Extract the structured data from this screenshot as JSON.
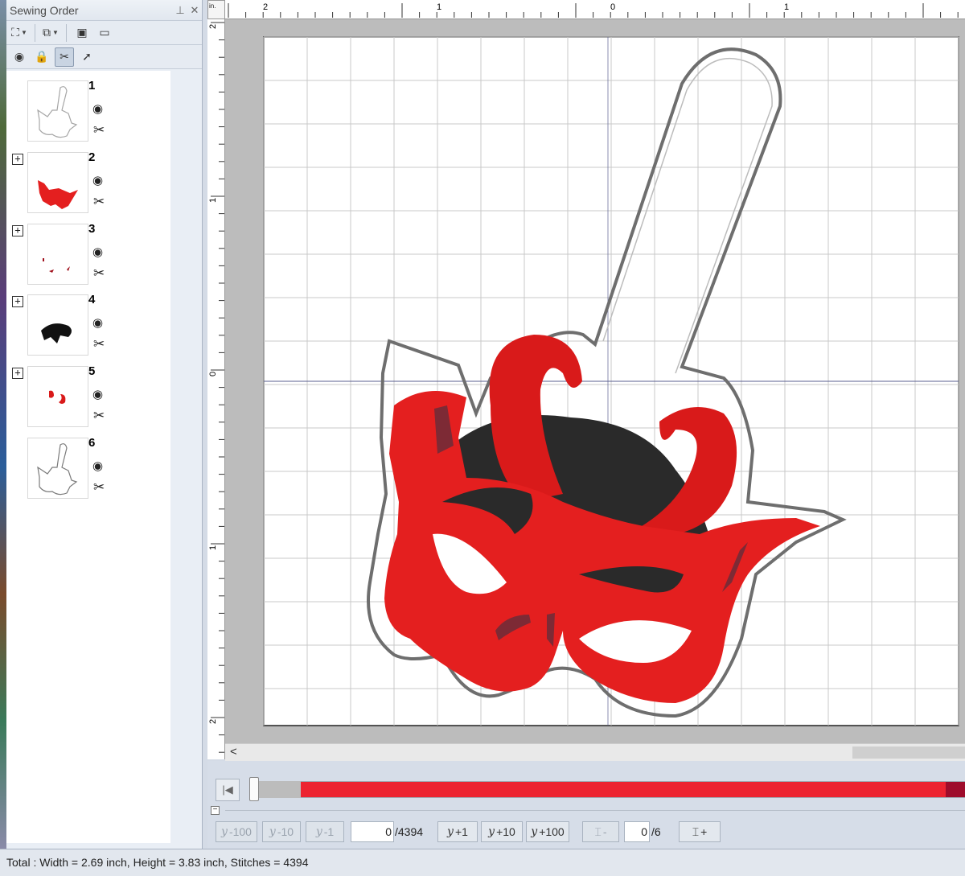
{
  "panel": {
    "title": "Sewing Order",
    "pin_glyph": "ᵃ",
    "close_glyph": "✕",
    "toolbar1": [
      {
        "name": "select-design-icon",
        "glyph": "⛶",
        "dropdown": true
      },
      {
        "name": "group-icon",
        "glyph": "⧉",
        "dropdown": true
      },
      {
        "name": "color-order-icon",
        "glyph": "▣",
        "dropdown": false
      },
      {
        "name": "frame-icon",
        "glyph": "▭",
        "dropdown": false
      }
    ],
    "toolbar2": [
      {
        "name": "visibility-icon",
        "glyph": "◉"
      },
      {
        "name": "lock-icon",
        "glyph": "🔒"
      },
      {
        "name": "cut-tool-icon",
        "glyph": "✂"
      },
      {
        "name": "pointer-icon",
        "glyph": "➚"
      }
    ],
    "items": [
      {
        "num": "1",
        "expandable": false,
        "color": "#a6a6a6",
        "kind": "outline"
      },
      {
        "num": "2",
        "expandable": true,
        "color": "#e41f1f",
        "kind": "mask"
      },
      {
        "num": "3",
        "expandable": true,
        "color": "#a0101c",
        "kind": "dots"
      },
      {
        "num": "4",
        "expandable": true,
        "color": "#111111",
        "kind": "dark"
      },
      {
        "num": "5",
        "expandable": true,
        "color": "#d91a1a",
        "kind": "horns"
      },
      {
        "num": "6",
        "expandable": false,
        "color": "#7a7a7a",
        "kind": "outline"
      }
    ],
    "eye_glyph": "👁",
    "scissor_glyph": "✂"
  },
  "ruler": {
    "unit": "in.",
    "h_labels": [
      "2",
      "1",
      "0",
      "1"
    ],
    "v_labels": [
      "2",
      "1",
      "0",
      "1",
      "2"
    ]
  },
  "scroll": {
    "left_arrow": "<"
  },
  "playback": {
    "first_glyph": "|◀",
    "collapse_glyph": "−"
  },
  "stitch_controls": {
    "minus100": "-100",
    "minus10": "-10",
    "minus1": "-1",
    "current_stitch": "0",
    "total_stitches": "/4394",
    "plus1": "+1",
    "plus10": "+10",
    "plus100": "+100",
    "stitch_glyph": "𝑦",
    "color_minus": "-",
    "current_color": "0",
    "total_colors": "/6",
    "color_plus": "+"
  },
  "status": {
    "text": "Total : Width = 2.69 inch, Height = 3.83 inch, Stitches = 4394"
  },
  "colors": {
    "mask_red": "#e41f1f",
    "dark_red": "#7d2a35",
    "hair": "#2a2a2a",
    "outline": "#6e6e6e",
    "track_red": "#ec2330",
    "track_dark": "#9e0c2b"
  }
}
